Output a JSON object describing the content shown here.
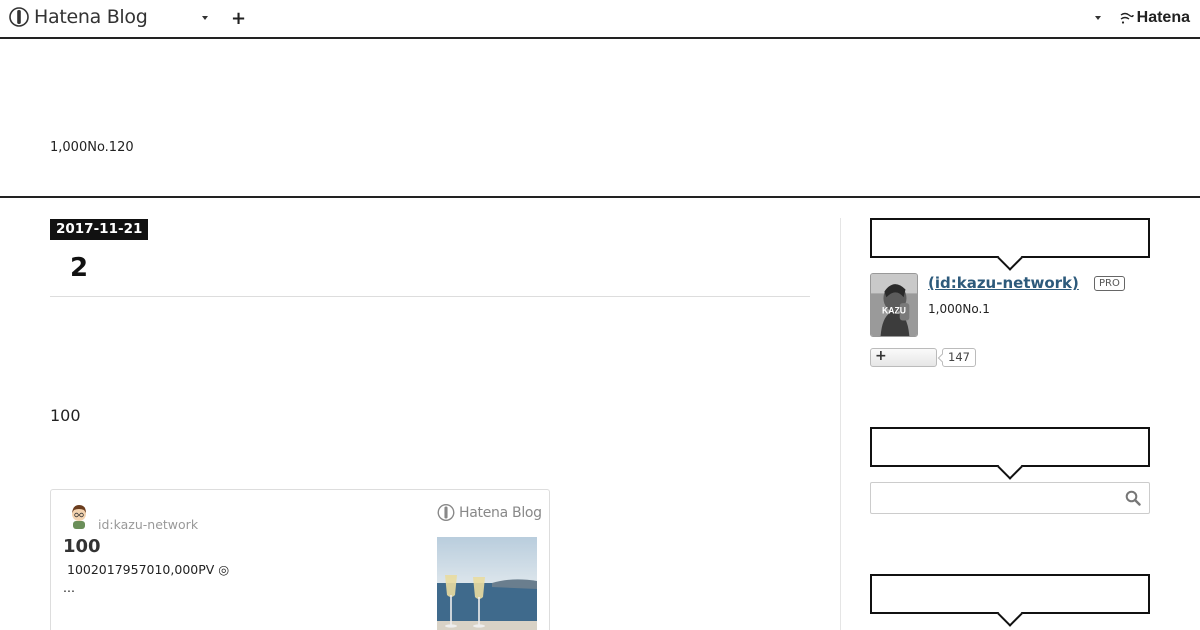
{
  "global_header": {
    "logo_text": "Hatena Blog",
    "brand_text": "Hatena",
    "plus_label": "+"
  },
  "blog_header": {
    "description": "1,000No.120"
  },
  "entry": {
    "date": "2017-11-21",
    "title": "2",
    "body_text": "100"
  },
  "embed_card": {
    "author_id": "id:kazu-network",
    "logo_text": "Hatena Blog",
    "title": "100",
    "summary": "1002017957010,000PV ◎",
    "ellipsis": "..."
  },
  "sidebar": {
    "profile": {
      "name": " (id:kazu-network)",
      "badge": "PRO",
      "description": "1,000No.1",
      "icon_text": "KAZU"
    },
    "follow": {
      "button_label": "+",
      "count": "147"
    },
    "search": {
      "placeholder": ""
    }
  },
  "colors": {
    "accent_dark": "#111111",
    "link": "#2d5a7b",
    "muted": "#999999"
  },
  "icons": [
    "hatena-blog-logo-icon",
    "caret-down-icon",
    "plus-icon",
    "hatena-logo-icon",
    "search-icon",
    "avatar-icon"
  ]
}
